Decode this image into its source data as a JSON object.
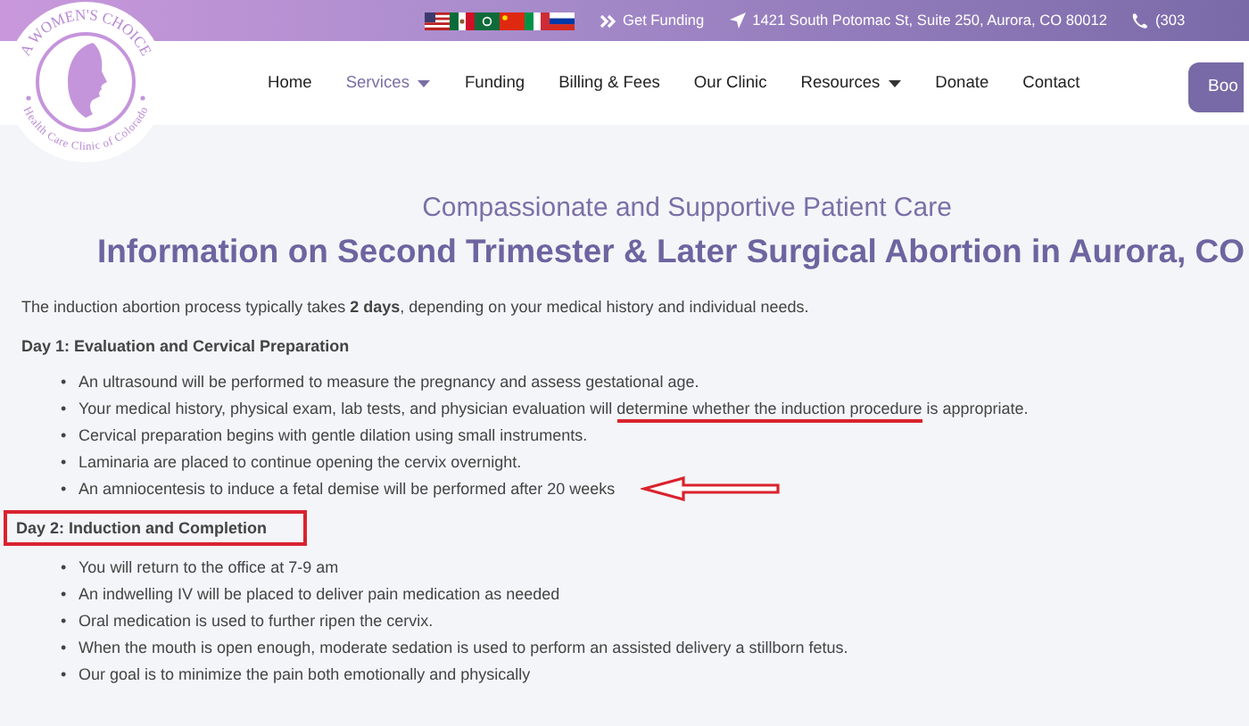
{
  "logo": {
    "top_text": "A WOMEN'S CHOICE",
    "bottom_text": "Health Care Clinic of Colorado"
  },
  "top_bar": {
    "links": [
      {
        "kind": "funding",
        "text": "Get Funding"
      },
      {
        "kind": "address",
        "text": "1421 South Potomac St, Suite 250, Aurora, CO 80012"
      },
      {
        "kind": "phone",
        "text": "(303"
      }
    ]
  },
  "nav": {
    "items": [
      {
        "label": "Home",
        "selected": false,
        "dropdown": false
      },
      {
        "label": "Services",
        "selected": true,
        "dropdown": true
      },
      {
        "label": "Funding",
        "selected": false,
        "dropdown": false
      },
      {
        "label": "Billing & Fees",
        "selected": false,
        "dropdown": false
      },
      {
        "label": "Our Clinic",
        "selected": false,
        "dropdown": false
      },
      {
        "label": "Resources",
        "selected": false,
        "dropdown": true
      },
      {
        "label": "Donate",
        "selected": false,
        "dropdown": false
      },
      {
        "label": "Contact",
        "selected": false,
        "dropdown": false
      }
    ],
    "button": "Boo"
  },
  "subtitle": "Compassionate and Supportive Patient Care",
  "title": "Information on Second Trimester & Later Surgical Abortion in Aurora, CO",
  "intro": "The induction abortion process typically takes **2 days**, depending on your medical history and individual needs.",
  "sections": [
    {
      "heading": "Day 1: Evaluation and Cervical Preparation",
      "boxed": false,
      "bullet": "•",
      "items": [
        {
          "parts": [
            {
              "text": "An ultrasound will be performed to measure the pregnancy and assess gestational age.",
              "underlined": false
            }
          ],
          "arrow": false
        },
        {
          "parts": [
            {
              "text": "Your medical history, physical exam, lab tests, and physician evaluation will ",
              "underlined": false
            },
            {
              "text": "determine whether the induction procedure",
              "underlined": true
            },
            {
              "text": " is appropriate.",
              "underlined": false
            }
          ],
          "arrow": false
        },
        {
          "parts": [
            {
              "text": "Cervical preparation begins with gentle dilation using small instruments.",
              "underlined": false
            }
          ],
          "arrow": false
        },
        {
          "parts": [
            {
              "text": "Laminaria are placed to continue opening the cervix overnight.",
              "underlined": false
            }
          ],
          "arrow": false
        },
        {
          "parts": [
            {
              "text": "An amniocentesis to induce a fetal demise will be performed after 20 weeks",
              "underlined": false
            }
          ],
          "arrow": true
        }
      ]
    },
    {
      "heading": "Day 2: Induction and Completion",
      "boxed": true,
      "bullet": "•",
      "items": [
        {
          "parts": [
            {
              "text": "You will return to the office at 7-9 am",
              "underlined": false
            }
          ],
          "arrow": false
        },
        {
          "parts": [
            {
              "text": "An indwelling IV will be placed to deliver pain medication as needed",
              "underlined": false
            }
          ],
          "arrow": false
        },
        {
          "parts": [
            {
              "text": "Oral medication is used to further ripen the cervix.",
              "underlined": false
            }
          ],
          "arrow": false
        },
        {
          "parts": [
            {
              "text": "When the mouth is open enough, moderate sedation is used to perform an assisted delivery a stillborn fetus.",
              "underlined": false
            }
          ],
          "arrow": false
        },
        {
          "parts": [
            {
              "text": "Our goal is to minimize the pain both emotionally and physically",
              "underlined": false
            }
          ],
          "arrow": false
        }
      ]
    }
  ]
}
